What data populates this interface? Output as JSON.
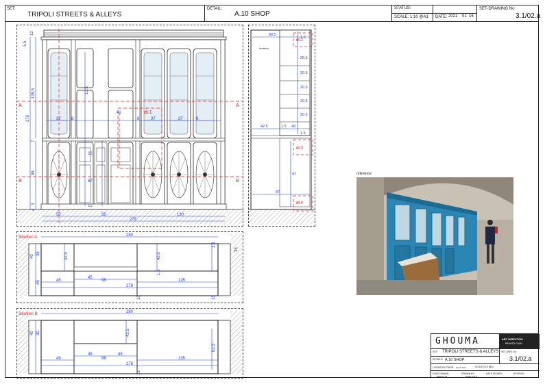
{
  "header": {
    "set_label": "SET:",
    "set_value": "TRIPOLI STREETS & ALLEYS",
    "detail_label": "DETAIL:",
    "detail_value": "A.10 SHOP",
    "status_label": "STATUS:",
    "scale_text": "SCALE: 1:10 @A1",
    "date_label": "DATE:",
    "date_year": "2021",
    "date_month": "01",
    "date_day": "16",
    "set_drawing_label": "SET-DRAWING No:",
    "set_drawing_value": "3.1/02.a"
  },
  "elevation": {
    "dims_left": [
      "5.5",
      "12",
      "135.5",
      "279",
      "7",
      "95",
      "3",
      "4"
    ],
    "dims_center": [
      "13.5",
      "41",
      "22",
      "67",
      "12"
    ],
    "dims_row": [
      "37",
      "8",
      "8",
      "37",
      "37",
      "8"
    ],
    "dims_bottom": [
      "50",
      "58",
      "130",
      "278"
    ],
    "detail_tag": "dt.1",
    "section_a": "A",
    "section_b": "B"
  },
  "side": {
    "top_dim": "88.5",
    "label_text": "location:",
    "dims_right": [
      "1.5",
      "26.5",
      "20.5",
      "20.5",
      "20.5",
      "20.5",
      "1.5"
    ],
    "dims_misc": [
      "42.5",
      "1.5",
      "40",
      "97",
      "87"
    ],
    "detail_tags": [
      "dt.2",
      "dt.3",
      "dt.4"
    ]
  },
  "section_a": {
    "title": "Section A",
    "top_dim": "280",
    "dims": [
      "40",
      "35",
      "42.5",
      "42.5",
      "1.5",
      "1.5",
      "45",
      "45",
      "96",
      "135",
      "278",
      "15",
      "15",
      "35",
      "45"
    ]
  },
  "section_b": {
    "title": "Section B",
    "top_dim": "280",
    "dims": [
      "40",
      "30",
      "42.5",
      "45",
      "96",
      "45",
      "45",
      "135",
      "278",
      "62.5",
      "15"
    ]
  },
  "reference": {
    "label": "reference:"
  },
  "title_block": {
    "logo": "GHOUMA",
    "art_director_label": "ART DIRECTOR:",
    "art_director_value": "RENATO CASH",
    "set_label": "SET:",
    "set_value": "TRIPOLI STREETS & ALLEYS",
    "set_dwg_label": "SET-DWG No:",
    "set_dwg_value": "3.1/02.a",
    "details_label": "DETAILS:",
    "details_value": "A.10 SHOP",
    "location_stage_label": "LOCATION STAGE:",
    "location_stage_value": "shops area",
    "scale_label": "SCALE:",
    "scale_value": "1:10 @A1",
    "date_drawn_label": "DATE DRAWN:",
    "date_drawn_value": "2021.01.16",
    "drawn_by_label": "DRAWN BY:",
    "drawn_by_value": "ALMA TOTH",
    "date_issued_label": "DATE ISSUED:",
    "revised_label": "REVISED:"
  }
}
